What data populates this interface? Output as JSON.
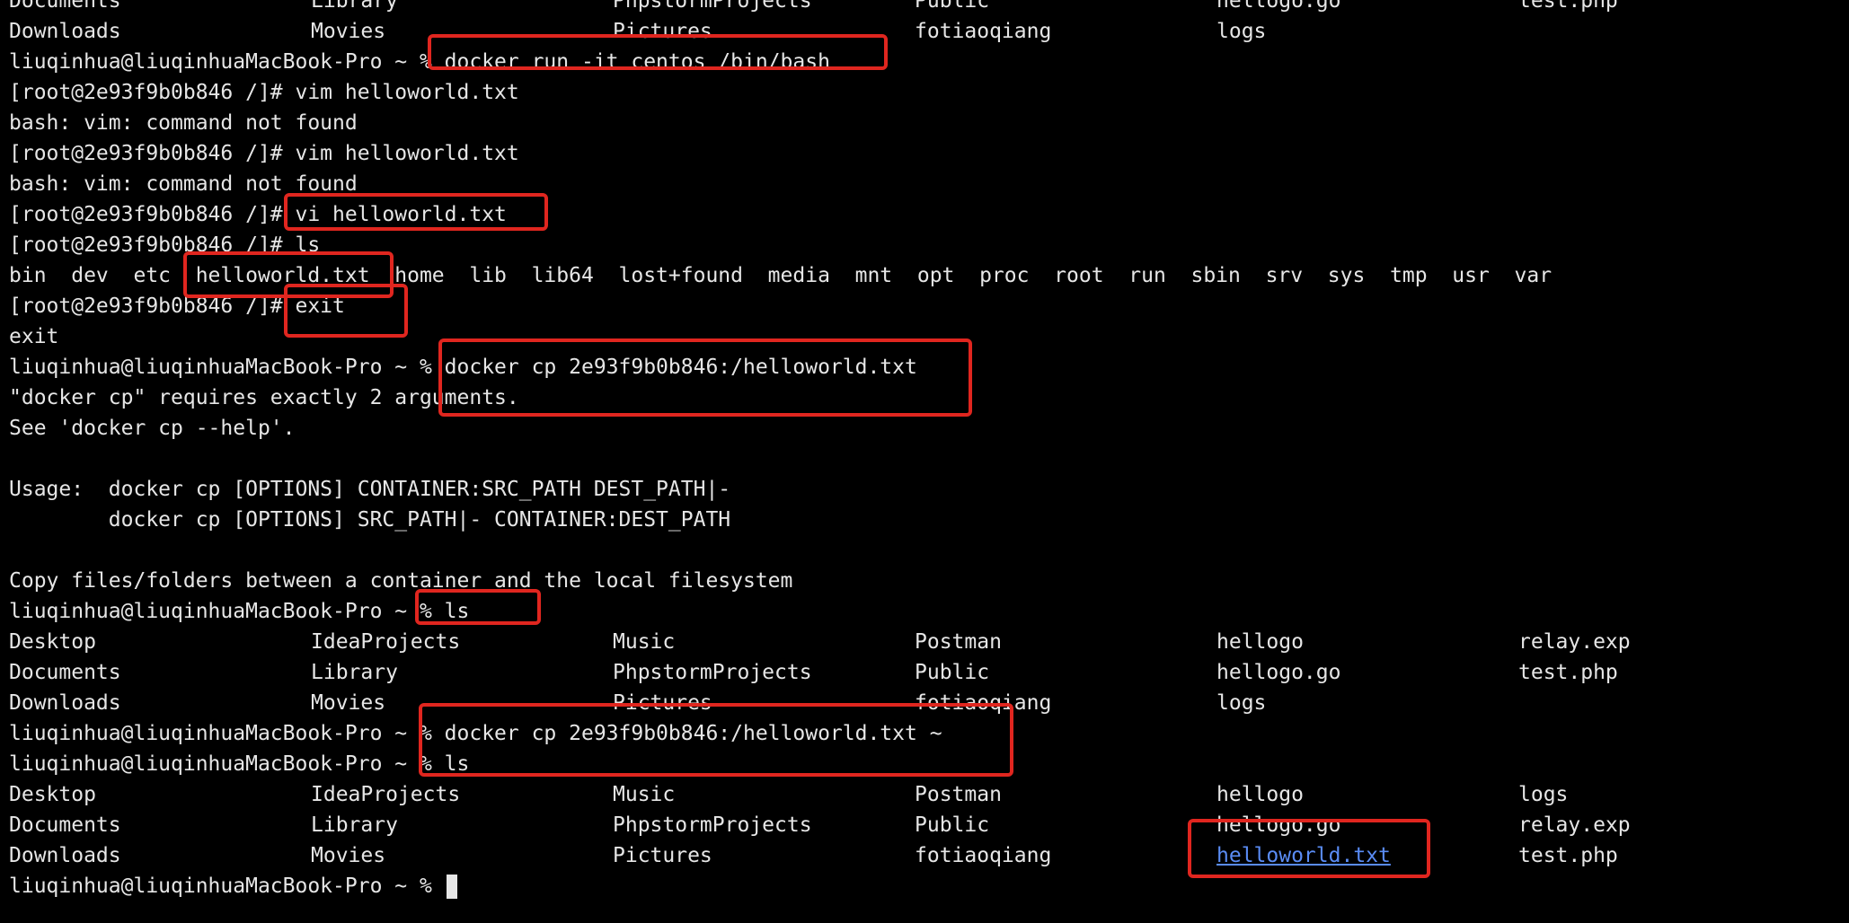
{
  "theme": {
    "background": "#000000",
    "foreground": "#e6e6e6",
    "highlight_box": "#e0261f",
    "link": "#5a8cf5"
  },
  "terminal": {
    "lines": [
      {
        "type": "ls",
        "cols": [
          "Documents",
          "Library",
          "PhpstormProjects",
          "Public",
          "hellogo.go",
          "test.php"
        ]
      },
      {
        "type": "ls",
        "cols": [
          "Downloads",
          "Movies",
          "Pictures",
          "fotiaoqiang",
          "logs",
          ""
        ]
      },
      {
        "type": "text",
        "text": "liuqinhua@liuqinhuaMacBook-Pro ~ % docker run -it centos /bin/bash"
      },
      {
        "type": "text",
        "text": "[root@2e93f9b0b846 /]# vim helloworld.txt"
      },
      {
        "type": "text",
        "text": "bash: vim: command not found"
      },
      {
        "type": "text",
        "text": "[root@2e93f9b0b846 /]# vim helloworld.txt"
      },
      {
        "type": "text",
        "text": "bash: vim: command not found"
      },
      {
        "type": "text",
        "text": "[root@2e93f9b0b846 /]# vi helloworld.txt"
      },
      {
        "type": "text",
        "text": "[root@2e93f9b0b846 /]# ls"
      },
      {
        "type": "text",
        "text": "bin  dev  etc  helloworld.txt  home  lib  lib64  lost+found  media  mnt  opt  proc  root  run  sbin  srv  sys  tmp  usr  var"
      },
      {
        "type": "text",
        "text": "[root@2e93f9b0b846 /]# exit"
      },
      {
        "type": "text",
        "text": "exit"
      },
      {
        "type": "text",
        "text": "liuqinhua@liuqinhuaMacBook-Pro ~ % docker cp 2e93f9b0b846:/helloworld.txt"
      },
      {
        "type": "text",
        "text": "\"docker cp\" requires exactly 2 arguments."
      },
      {
        "type": "text",
        "text": "See 'docker cp --help'."
      },
      {
        "type": "text",
        "text": ""
      },
      {
        "type": "text",
        "text": "Usage:  docker cp [OPTIONS] CONTAINER:SRC_PATH DEST_PATH|-"
      },
      {
        "type": "text",
        "text": "        docker cp [OPTIONS] SRC_PATH|- CONTAINER:DEST_PATH"
      },
      {
        "type": "text",
        "text": ""
      },
      {
        "type": "text",
        "text": "Copy files/folders between a container and the local filesystem"
      },
      {
        "type": "text",
        "text": "liuqinhua@liuqinhuaMacBook-Pro ~ % ls"
      },
      {
        "type": "ls",
        "cols": [
          "Desktop",
          "IdeaProjects",
          "Music",
          "Postman",
          "hellogo",
          "relay.exp"
        ]
      },
      {
        "type": "ls",
        "cols": [
          "Documents",
          "Library",
          "PhpstormProjects",
          "Public",
          "hellogo.go",
          "test.php"
        ]
      },
      {
        "type": "ls",
        "cols": [
          "Downloads",
          "Movies",
          "Pictures",
          "fotiaoqiang",
          "logs",
          ""
        ]
      },
      {
        "type": "text",
        "text": "liuqinhua@liuqinhuaMacBook-Pro ~ % docker cp 2e93f9b0b846:/helloworld.txt ~"
      },
      {
        "type": "text",
        "text": "liuqinhua@liuqinhuaMacBook-Pro ~ % ls"
      },
      {
        "type": "ls",
        "cols": [
          "Desktop",
          "IdeaProjects",
          "Music",
          "Postman",
          "hellogo",
          "logs"
        ]
      },
      {
        "type": "ls",
        "cols": [
          "Documents",
          "Library",
          "PhpstormProjects",
          "Public",
          "hellogo.go",
          "relay.exp"
        ]
      },
      {
        "type": "ls",
        "cols": [
          "Downloads",
          "Movies",
          "Pictures",
          "fotiaoqiang",
          "helloworld.txt",
          "test.php"
        ],
        "link_col": 4
      },
      {
        "type": "prompt",
        "text": "liuqinhua@liuqinhuaMacBook-Pro ~ % "
      }
    ]
  }
}
